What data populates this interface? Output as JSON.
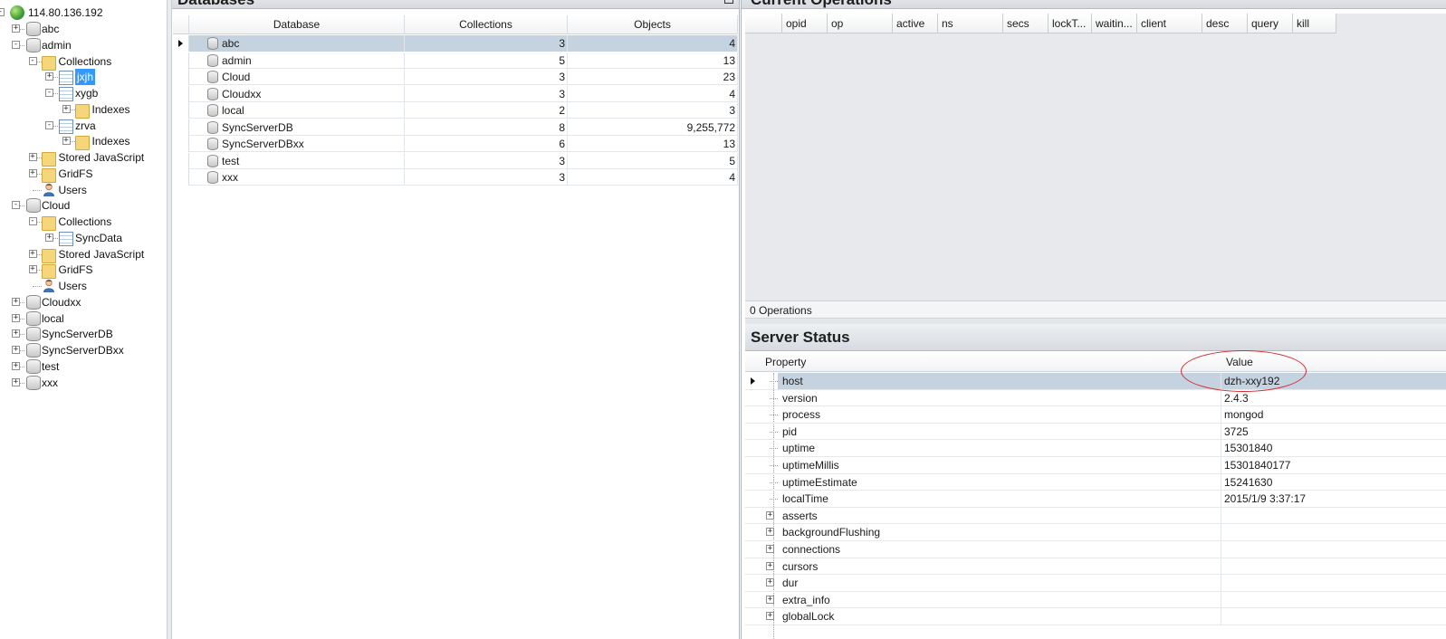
{
  "tree": {
    "server": "114.80.136.192",
    "items": [
      {
        "label": "abc",
        "icon": "database-icon",
        "level": 1,
        "expander": "+"
      },
      {
        "label": "admin",
        "icon": "database-icon",
        "level": 1,
        "expander": "-"
      },
      {
        "label": "Collections",
        "icon": "folder-icon",
        "level": 2,
        "expander": "-"
      },
      {
        "label": "jxjh",
        "icon": "table-icon",
        "level": 3,
        "expander": "+",
        "selected": true
      },
      {
        "label": "xygb",
        "icon": "table-icon",
        "level": 3,
        "expander": "-"
      },
      {
        "label": "Indexes",
        "icon": "folder-icon",
        "level": 4,
        "expander": "+"
      },
      {
        "label": "zrva",
        "icon": "table-icon",
        "level": 3,
        "expander": "-"
      },
      {
        "label": "Indexes",
        "icon": "folder-icon",
        "level": 4,
        "expander": "+"
      },
      {
        "label": "Stored JavaScript",
        "icon": "folder-icon",
        "level": 2,
        "expander": "+"
      },
      {
        "label": "GridFS",
        "icon": "folder-icon",
        "level": 2,
        "expander": "+"
      },
      {
        "label": "Users",
        "icon": "user-icon",
        "level": 2,
        "expander": ""
      },
      {
        "label": "Cloud",
        "icon": "database-icon",
        "level": 1,
        "expander": "-"
      },
      {
        "label": "Collections",
        "icon": "folder-icon",
        "level": 2,
        "expander": "-"
      },
      {
        "label": "SyncData",
        "icon": "table-icon",
        "level": 3,
        "expander": "+"
      },
      {
        "label": "Stored JavaScript",
        "icon": "folder-icon",
        "level": 2,
        "expander": "+"
      },
      {
        "label": "GridFS",
        "icon": "folder-icon",
        "level": 2,
        "expander": "+"
      },
      {
        "label": "Users",
        "icon": "user-icon",
        "level": 2,
        "expander": ""
      },
      {
        "label": "Cloudxx",
        "icon": "database-icon",
        "level": 1,
        "expander": "+"
      },
      {
        "label": "local",
        "icon": "database-icon",
        "level": 1,
        "expander": "+"
      },
      {
        "label": "SyncServerDB",
        "icon": "database-icon",
        "level": 1,
        "expander": "+"
      },
      {
        "label": "SyncServerDBxx",
        "icon": "database-icon",
        "level": 1,
        "expander": "+"
      },
      {
        "label": "test",
        "icon": "database-icon",
        "level": 1,
        "expander": "+"
      },
      {
        "label": "xxx",
        "icon": "database-icon",
        "level": 1,
        "expander": "+"
      }
    ]
  },
  "databases": {
    "title": "Databases",
    "columns": [
      "Database",
      "Collections",
      "Objects"
    ],
    "rows": [
      {
        "name": "abc",
        "collections": "3",
        "objects": "4",
        "selected": true
      },
      {
        "name": "admin",
        "collections": "5",
        "objects": "13"
      },
      {
        "name": "Cloud",
        "collections": "3",
        "objects": "23"
      },
      {
        "name": "Cloudxx",
        "collections": "3",
        "objects": "4"
      },
      {
        "name": "local",
        "collections": "2",
        "objects": "3"
      },
      {
        "name": "SyncServerDB",
        "collections": "8",
        "objects": "9,255,772"
      },
      {
        "name": "SyncServerDBxx",
        "collections": "6",
        "objects": "13"
      },
      {
        "name": "test",
        "collections": "3",
        "objects": "5"
      },
      {
        "name": "xxx",
        "collections": "3",
        "objects": "4"
      }
    ]
  },
  "current_operations": {
    "title": "Current Operations",
    "columns": [
      "opid",
      "op",
      "active",
      "ns",
      "secs",
      "lockT...",
      "waitin...",
      "client",
      "desc",
      "query",
      "kill"
    ],
    "status": "0 Operations"
  },
  "server_status": {
    "title": "Server Status",
    "columns": [
      "Property",
      "Value"
    ],
    "rows": [
      {
        "property": "host",
        "value": "dzh-xxy192",
        "expandable": false,
        "selected": true
      },
      {
        "property": "version",
        "value": "2.4.3",
        "expandable": false
      },
      {
        "property": "process",
        "value": "mongod",
        "expandable": false
      },
      {
        "property": "pid",
        "value": "3725",
        "expandable": false
      },
      {
        "property": "uptime",
        "value": "15301840",
        "expandable": false
      },
      {
        "property": "uptimeMillis",
        "value": "15301840177",
        "expandable": false
      },
      {
        "property": "uptimeEstimate",
        "value": "15241630",
        "expandable": false
      },
      {
        "property": "localTime",
        "value": "2015/1/9 3:37:17",
        "expandable": false
      },
      {
        "property": "asserts",
        "value": "",
        "expandable": true
      },
      {
        "property": "backgroundFlushing",
        "value": "",
        "expandable": true
      },
      {
        "property": "connections",
        "value": "",
        "expandable": true
      },
      {
        "property": "cursors",
        "value": "",
        "expandable": true
      },
      {
        "property": "dur",
        "value": "",
        "expandable": true
      },
      {
        "property": "extra_info",
        "value": "",
        "expandable": true
      },
      {
        "property": "globalLock",
        "value": "",
        "expandable": true
      }
    ]
  },
  "colors": {
    "selection": "#c5d2df",
    "tree_selection": "#3399ff",
    "annotation_ellipse": "#d8282c"
  }
}
